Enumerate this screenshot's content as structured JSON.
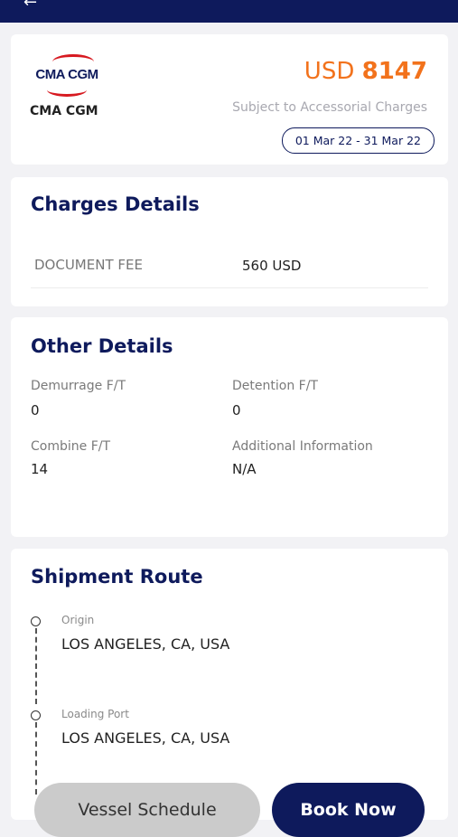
{
  "carrier": {
    "logo_text": "CMA CGM",
    "name": "CMA CGM"
  },
  "rate": {
    "currency": "USD",
    "amount": "8147",
    "subject": "Subject to Accessorial Charges",
    "validity": "01 Mar 22 - 31 Mar 22"
  },
  "charges": {
    "title": "Charges Details",
    "items": [
      {
        "label": "DOCUMENT FEE",
        "value": "560 USD"
      }
    ]
  },
  "other": {
    "title": "Other Details",
    "demurrage_label": "Demurrage F/T",
    "demurrage_value": "0",
    "detention_label": "Detention F/T",
    "detention_value": "0",
    "combine_label": "Combine F/T",
    "combine_value": "14",
    "additional_label": "Additional Information",
    "additional_value": "N/A"
  },
  "route": {
    "title": "Shipment Route",
    "stops": [
      {
        "label": "Origin",
        "value": "LOS ANGELES, CA, USA"
      },
      {
        "label": "Loading Port",
        "value": "LOS ANGELES, CA, USA"
      }
    ]
  },
  "actions": {
    "vessel_schedule": "Vessel Schedule",
    "book_now": "Book Now"
  },
  "colors": {
    "navy": "#0e1a5c",
    "orange": "#f2721c",
    "brand_red": "#d71920"
  }
}
